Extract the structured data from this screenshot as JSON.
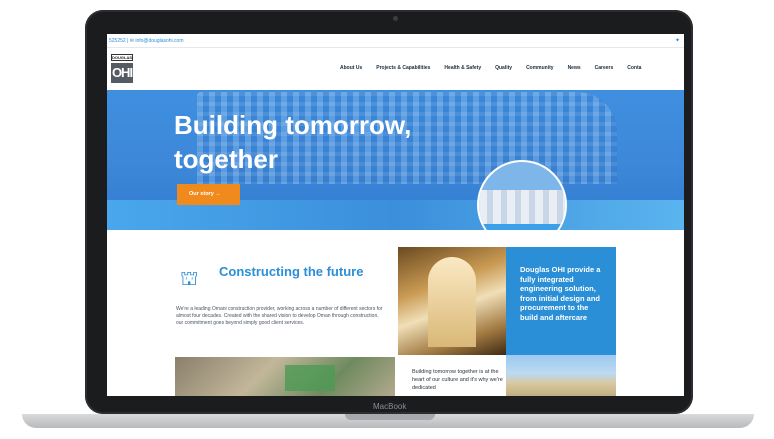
{
  "device": {
    "brand_label": "MacBook"
  },
  "topbar": {
    "contact": "525252 | ✉ info@douglasohi.com",
    "social_icon": "twitter-icon"
  },
  "logo": {
    "top_text": "DOUGLAS",
    "bottom_text": "OHI"
  },
  "nav": {
    "items": [
      "About Us",
      "Projects & Capabilities",
      "Health & Safety",
      "Quality",
      "Community",
      "News",
      "Careers",
      "Conta"
    ]
  },
  "hero": {
    "title": "Building tomorrow, together",
    "cta_label": "Our story →"
  },
  "feature": {
    "title": "Constructing the future",
    "body": "We're a leading Omani construction provider, working across a number of different sectors for almost four decades. Created with the shared vision to develop Oman through construction, our commitment goes beyond simply good client services."
  },
  "bluebox": {
    "text": "Douglas OHI provide a fully integrated engineering solution, from initial design and procurement to the build and aftercare"
  },
  "tagbox": {
    "text": "Building tomorrow together is at the heart of our culture and it's why we're dedicated"
  },
  "colors": {
    "accent": "#2a8fd6",
    "cta": "#f08a1c"
  }
}
